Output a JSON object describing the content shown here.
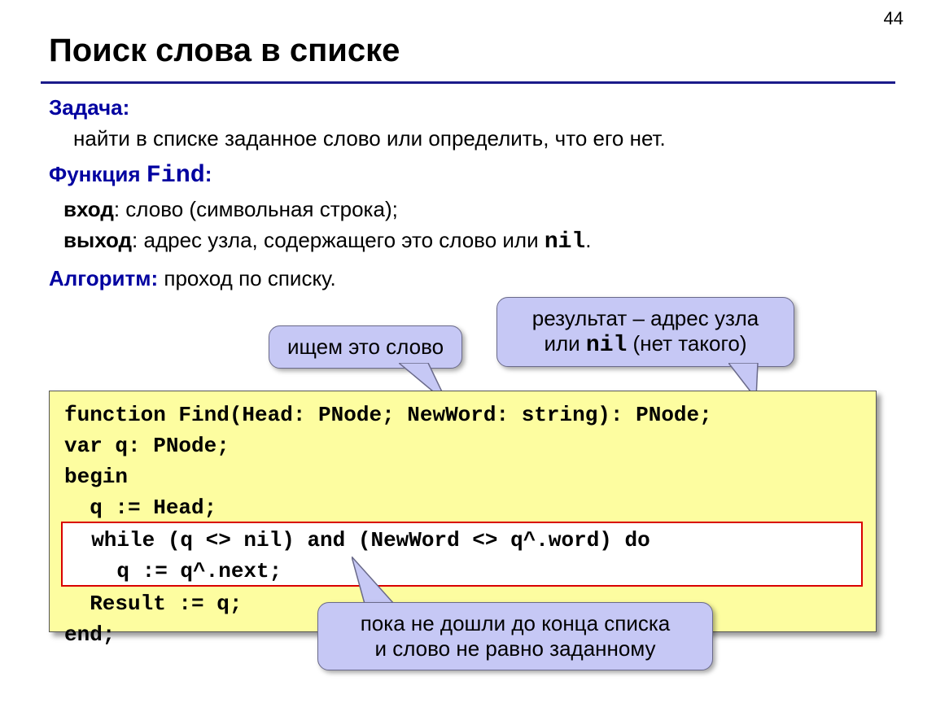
{
  "page_number": "44",
  "title": "Поиск слова в списке",
  "task": {
    "label": "Задача:",
    "text": "найти в списке заданное слово или определить, что его нет."
  },
  "func": {
    "label_prefix": "Функция ",
    "label_name": "Find",
    "label_suffix": ":",
    "in_label": "вход",
    "in_text": ":   слово (символьная строка);",
    "out_label": "выход",
    "out_prefix": ": адрес узла, содержащего это слово или ",
    "out_mono": "nil",
    "out_suffix": "."
  },
  "algo": {
    "label": "Алгоритм:",
    "text": " проход по списку."
  },
  "callouts": {
    "c1": "ищем это слово",
    "c2_line1": "результат – адрес узла",
    "c2_pref": "или ",
    "c2_mono": "nil",
    "c2_suf": " (нет такого)",
    "c3_line1": "пока не дошли до конца списка",
    "c3_line2": "и слово не равно заданному"
  },
  "code": {
    "l1": "function Find(Head: PNode; NewWord: string): PNode;",
    "l2": "var q: PNode;",
    "l3": "begin",
    "l4": "  q := Head;",
    "red1": "  while (q <> nil) and (NewWord <> q^.word) do",
    "red2": "    q := q^.next;",
    "l7": "  Result := q;",
    "l8": "end;"
  }
}
